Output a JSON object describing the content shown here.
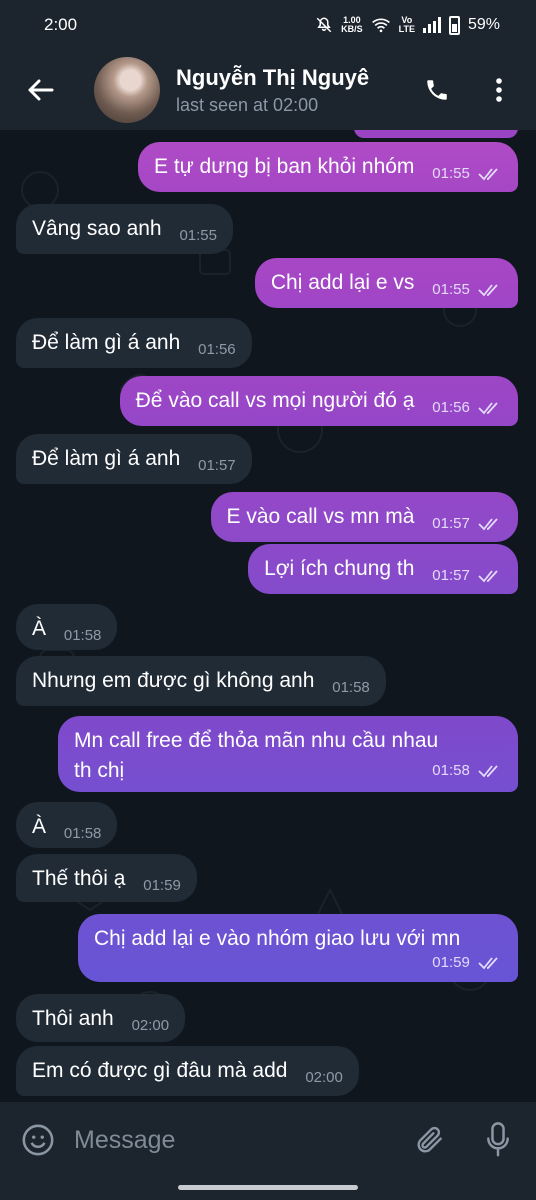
{
  "status": {
    "time": "2:00",
    "net_speed_value": "1.00",
    "net_speed_unit": "KB/S",
    "volte_top": "Vo",
    "volte_bottom": "LTE",
    "battery": "59%"
  },
  "header": {
    "name": "Nguyễn Thị Nguyê",
    "last_seen": "last seen at 02:00"
  },
  "messages": [
    {
      "dir": "out",
      "text": "E tự dưng bị ban khỏi nhóm",
      "time": "01:55"
    },
    {
      "dir": "in",
      "text": "Vâng sao anh",
      "time": "01:55"
    },
    {
      "dir": "out",
      "text": "Chị add lại e vs",
      "time": "01:55"
    },
    {
      "dir": "in",
      "text": "Để làm gì á anh",
      "time": "01:56"
    },
    {
      "dir": "out",
      "text": "Để vào call vs mọi người đó ạ",
      "time": "01:56"
    },
    {
      "dir": "in",
      "text": "Để làm gì á anh",
      "time": "01:57"
    },
    {
      "dir": "out",
      "text": "E vào call vs mn mà",
      "time": "01:57"
    },
    {
      "dir": "out",
      "text": "Lợi ích chung th",
      "time": "01:57"
    },
    {
      "dir": "in",
      "text": "À",
      "time": "01:58"
    },
    {
      "dir": "in",
      "text": "Nhưng em được gì không anh",
      "time": "01:58"
    },
    {
      "dir": "out",
      "text_line1": "Mn call free để thỏa mãn nhu cầu nhau",
      "text_line2": "th chị",
      "time": "01:58"
    },
    {
      "dir": "in",
      "text": "À",
      "time": "01:58"
    },
    {
      "dir": "in",
      "text": "Thế thôi ạ",
      "time": "01:59"
    },
    {
      "dir": "out",
      "text": "Chị add lại e vào nhóm giao lưu với mn",
      "time": "01:59"
    },
    {
      "dir": "in",
      "text": "Thôi anh",
      "time": "02:00"
    },
    {
      "dir": "in",
      "text": "Em có được gì đâu mà add",
      "time": "02:00"
    }
  ],
  "input": {
    "placeholder": "Message"
  },
  "icons": {
    "back": "arrow-left-icon",
    "call": "phone-icon",
    "menu": "more-vert-icon",
    "emoji": "emoji-icon",
    "attach": "paperclip-icon",
    "mic": "microphone-icon"
  },
  "colors": {
    "background": "#0f161d",
    "bar": "#1c242d",
    "incoming_bubble": "#212b36",
    "outgoing_gradient_top": "#b04ac7",
    "outgoing_gradient_bottom": "#6a56de"
  }
}
